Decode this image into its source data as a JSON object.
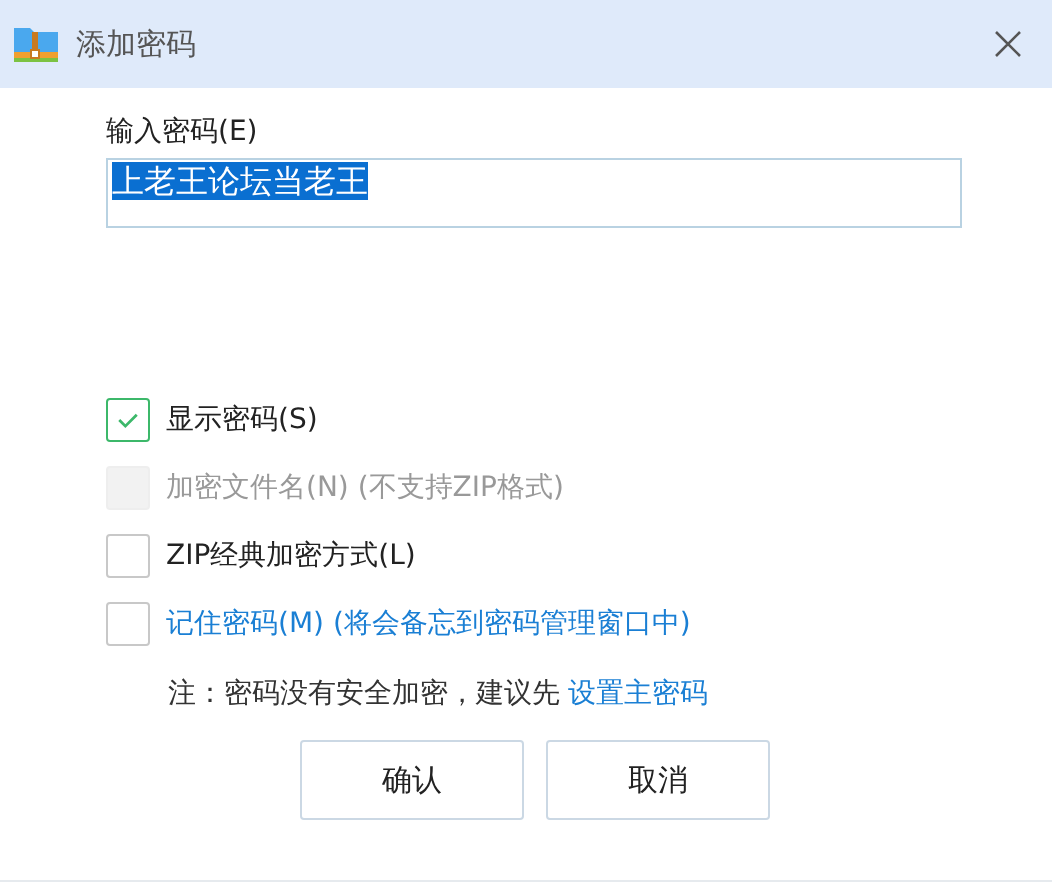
{
  "window": {
    "title": "添加密码"
  },
  "password": {
    "label": "输入密码(E)",
    "value": "上老王论坛当老王",
    "selected": true
  },
  "options": [
    {
      "kind": "check",
      "label": "显示密码(S)",
      "checked": true,
      "disabled": false
    },
    {
      "kind": "check",
      "label": "加密文件名(N) (不支持ZIP格式)",
      "checked": false,
      "disabled": true
    },
    {
      "kind": "check",
      "label": "ZIP经典加密方式(L)",
      "checked": false,
      "disabled": false
    },
    {
      "kind": "link",
      "label": "记住密码(M) (将会备忘到密码管理窗口中)",
      "checked": false,
      "disabled": false
    }
  ],
  "note": {
    "text": "注：密码没有安全加密，建议先",
    "link": "设置主密码"
  },
  "buttons": [
    "确认",
    "取消"
  ]
}
